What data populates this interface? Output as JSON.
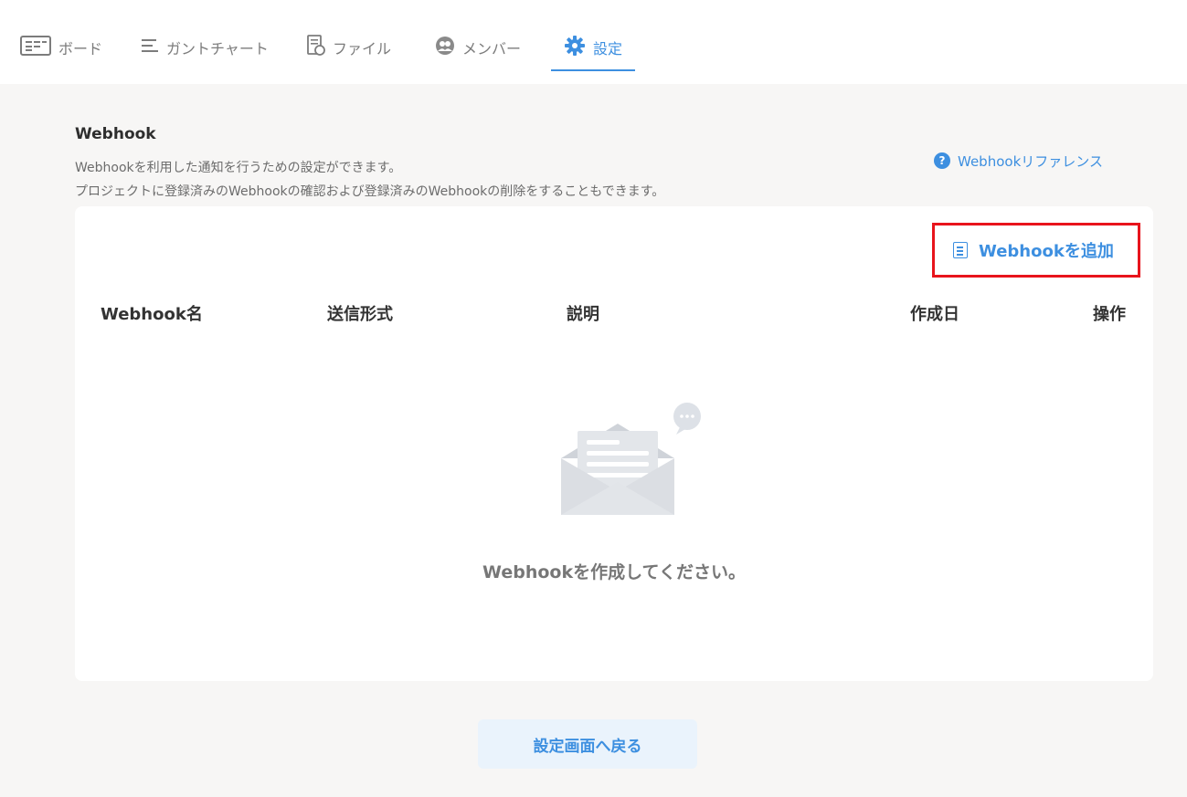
{
  "nav": {
    "tabs": [
      {
        "label": "ボード",
        "icon": "board-icon"
      },
      {
        "label": "ガントチャート",
        "icon": "gantt-icon"
      },
      {
        "label": "ファイル",
        "icon": "file-icon"
      },
      {
        "label": "メンバー",
        "icon": "member-icon"
      },
      {
        "label": "設定",
        "icon": "gear-icon",
        "active": true
      }
    ]
  },
  "section": {
    "title": "Webhook",
    "desc1": "Webhookを利用した通知を行うための設定ができます。",
    "desc2": "プロジェクトに登録済みのWebhookの確認および登録済みのWebhookの削除をすることもできます。",
    "reference_link": "Webhookリファレンス"
  },
  "table": {
    "add_button": "Webhookを追加",
    "headers": [
      "Webhook名",
      "送信形式",
      "説明",
      "作成日",
      "操作"
    ],
    "empty_message": "Webhookを作成してください。"
  },
  "footer": {
    "back_button": "設定画面へ戻る"
  },
  "colors": {
    "accent": "#3d8fe0",
    "highlight_border": "#e8141c",
    "background": "#f7f6f5"
  }
}
